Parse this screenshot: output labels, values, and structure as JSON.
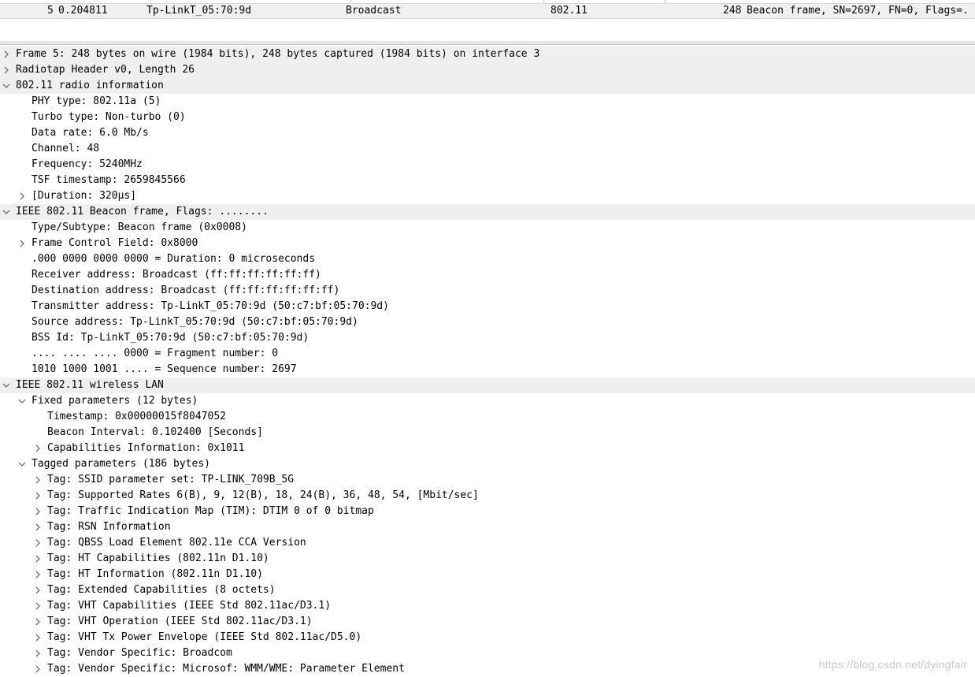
{
  "packet_list": {
    "selected_row": {
      "no": "5",
      "time": "0.204811",
      "source": "Tp-LinkT_05:70:9d",
      "destination": "Broadcast",
      "protocol": "802.11",
      "length": "248",
      "info": "Beacon frame, SN=2697, FN=0, Flags=."
    }
  },
  "packet_details": [
    {
      "label": "Frame 5: 248 bytes on wire (1984 bits), 248 bytes captured (1984 bits) on interface 3",
      "level": 0,
      "expander": "collapsed"
    },
    {
      "label": "Radiotap Header v0, Length 26",
      "level": 0,
      "expander": "collapsed"
    },
    {
      "label": "802.11 radio information",
      "level": 0,
      "expander": "expanded"
    },
    {
      "label": "PHY type: 802.11a (5)",
      "level": 1,
      "expander": "none"
    },
    {
      "label": "Turbo type: Non-turbo (0)",
      "level": 1,
      "expander": "none"
    },
    {
      "label": "Data rate: 6.0 Mb/s",
      "level": 1,
      "expander": "none"
    },
    {
      "label": "Channel: 48",
      "level": 1,
      "expander": "none"
    },
    {
      "label": "Frequency: 5240MHz",
      "level": 1,
      "expander": "none"
    },
    {
      "label": "TSF timestamp: 2659845566",
      "level": 1,
      "expander": "none"
    },
    {
      "label": "[Duration: 320µs]",
      "level": 1,
      "expander": "collapsed"
    },
    {
      "label": "IEEE 802.11 Beacon frame, Flags: ........",
      "level": 0,
      "expander": "expanded"
    },
    {
      "label": "Type/Subtype: Beacon frame (0x0008)",
      "level": 1,
      "expander": "none"
    },
    {
      "label": "Frame Control Field: 0x8000",
      "level": 1,
      "expander": "collapsed"
    },
    {
      "label": ".000 0000 0000 0000 = Duration: 0 microseconds",
      "level": 1,
      "expander": "none"
    },
    {
      "label": "Receiver address: Broadcast (ff:ff:ff:ff:ff:ff)",
      "level": 1,
      "expander": "none"
    },
    {
      "label": "Destination address: Broadcast (ff:ff:ff:ff:ff:ff)",
      "level": 1,
      "expander": "none"
    },
    {
      "label": "Transmitter address: Tp-LinkT_05:70:9d (50:c7:bf:05:70:9d)",
      "level": 1,
      "expander": "none"
    },
    {
      "label": "Source address: Tp-LinkT_05:70:9d (50:c7:bf:05:70:9d)",
      "level": 1,
      "expander": "none"
    },
    {
      "label": "BSS Id: Tp-LinkT_05:70:9d (50:c7:bf:05:70:9d)",
      "level": 1,
      "expander": "none"
    },
    {
      "label": ".... .... .... 0000 = Fragment number: 0",
      "level": 1,
      "expander": "none"
    },
    {
      "label": "1010 1000 1001 .... = Sequence number: 2697",
      "level": 1,
      "expander": "none"
    },
    {
      "label": "IEEE 802.11 wireless LAN",
      "level": 0,
      "expander": "expanded"
    },
    {
      "label": "Fixed parameters (12 bytes)",
      "level": 1,
      "expander": "expanded"
    },
    {
      "label": "Timestamp: 0x00000015f8047052",
      "level": 2,
      "expander": "none"
    },
    {
      "label": "Beacon Interval: 0.102400 [Seconds]",
      "level": 2,
      "expander": "none"
    },
    {
      "label": "Capabilities Information: 0x1011",
      "level": 2,
      "expander": "collapsed"
    },
    {
      "label": "Tagged parameters (186 bytes)",
      "level": 1,
      "expander": "expanded"
    },
    {
      "label": "Tag: SSID parameter set: TP-LINK_709B_5G",
      "level": 2,
      "expander": "collapsed"
    },
    {
      "label": "Tag: Supported Rates 6(B), 9, 12(B), 18, 24(B), 36, 48, 54, [Mbit/sec]",
      "level": 2,
      "expander": "collapsed"
    },
    {
      "label": "Tag: Traffic Indication Map (TIM): DTIM 0 of 0 bitmap",
      "level": 2,
      "expander": "collapsed"
    },
    {
      "label": "Tag: RSN Information",
      "level": 2,
      "expander": "collapsed"
    },
    {
      "label": "Tag: QBSS Load Element 802.11e CCA Version",
      "level": 2,
      "expander": "collapsed"
    },
    {
      "label": "Tag: HT Capabilities (802.11n D1.10)",
      "level": 2,
      "expander": "collapsed"
    },
    {
      "label": "Tag: HT Information (802.11n D1.10)",
      "level": 2,
      "expander": "collapsed"
    },
    {
      "label": "Tag: Extended Capabilities (8 octets)",
      "level": 2,
      "expander": "collapsed"
    },
    {
      "label": "Tag: VHT Capabilities (IEEE Std 802.11ac/D3.1)",
      "level": 2,
      "expander": "collapsed"
    },
    {
      "label": "Tag: VHT Operation (IEEE Std 802.11ac/D3.1)",
      "level": 2,
      "expander": "collapsed"
    },
    {
      "label": "Tag: VHT Tx Power Envelope (IEEE Std 802.11ac/D5.0)",
      "level": 2,
      "expander": "collapsed"
    },
    {
      "label": "Tag: Vendor Specific: Broadcom",
      "level": 2,
      "expander": "collapsed"
    },
    {
      "label": "Tag: Vendor Specific: Microsof: WMM/WME: Parameter Element",
      "level": 2,
      "expander": "collapsed"
    }
  ],
  "watermark": "https://blog.csdn.net/dyingfair",
  "colors": {
    "top_level_row_bg": "#efefef",
    "selected_packet_row_bg": "#f0f0f0",
    "expander_arrow": "#6e6e6e"
  },
  "icons": {
    "collapsed": "chevron-right-icon",
    "expanded": "chevron-down-icon"
  }
}
